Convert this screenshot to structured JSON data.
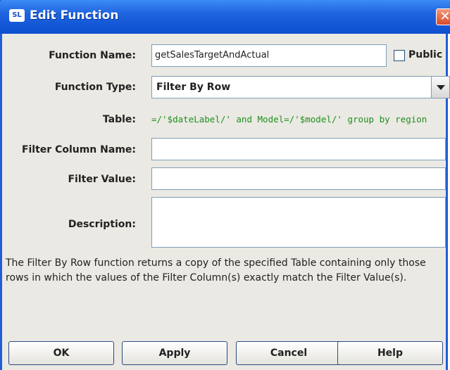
{
  "window": {
    "title": "Edit Function",
    "icon_text": "SL",
    "close_glyph": "✕"
  },
  "form": {
    "function_name": {
      "label": "Function Name:",
      "value": "getSalesTargetAndActual"
    },
    "public": {
      "label": "Public",
      "checked": false
    },
    "function_type": {
      "label": "Function Type:",
      "selected": "Filter By Row"
    },
    "table": {
      "label": "Table:",
      "value": "=/'$dateLabel/' and Model=/'$model/' group by region"
    },
    "filter_column_name": {
      "label": "Filter Column Name:",
      "value": ""
    },
    "filter_value": {
      "label": "Filter Value:",
      "value": ""
    },
    "description": {
      "label": "Description:",
      "value": ""
    }
  },
  "help_text": "The Filter By Row function returns a copy of the specified Table containing only those rows in which the values of the Filter Column(s) exactly match the Filter Value(s).",
  "buttons": {
    "ok": "OK",
    "apply": "Apply",
    "cancel": "Cancel",
    "help": "Help"
  },
  "colors": {
    "title_bar": "#1e63e0",
    "window_bg": "#ebe9e3",
    "table_text": "#1e8f1e",
    "close_button": "#d8492a"
  }
}
